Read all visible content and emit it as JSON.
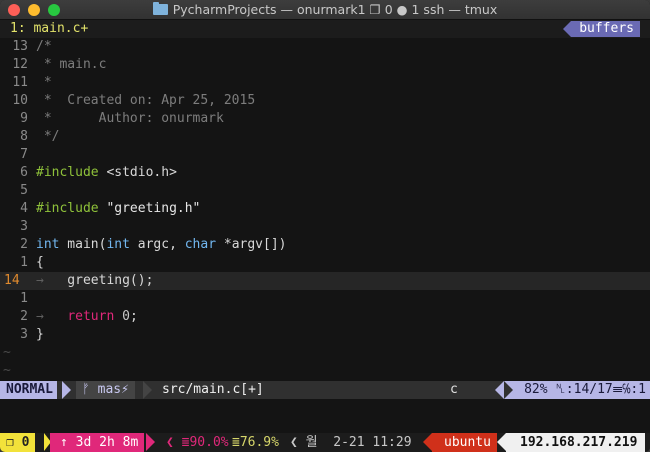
{
  "window": {
    "title": "PycharmProjects — onurmark1 ❐ 0 ● 1 ssh — tmux"
  },
  "tabline": {
    "current_tab": "1: main.c+",
    "buffers_label": "buffers"
  },
  "editor": {
    "lines": [
      {
        "num": "13",
        "text": "/*"
      },
      {
        "num": "12",
        "text": " * main.c"
      },
      {
        "num": "11",
        "text": " *"
      },
      {
        "num": "10",
        "text": " *  Created on: Apr 25, 2015"
      },
      {
        "num": "9",
        "text": " *      Author: onurmark"
      },
      {
        "num": "8",
        "text": " */"
      },
      {
        "num": "7",
        "text": ""
      },
      {
        "num": "6",
        "pre": "#include",
        "rest": " <stdio.h>"
      },
      {
        "num": "5",
        "text": ""
      },
      {
        "num": "4",
        "pre": "#include",
        "str": " \"greeting.h\""
      },
      {
        "num": "3",
        "text": ""
      },
      {
        "num": "2",
        "t1": "int",
        "m1": " main(",
        "t2": "int",
        "m2": " argc, ",
        "t3": "char",
        "m3": " *argv[])"
      },
      {
        "num": "1",
        "text": "{"
      },
      {
        "num": "14",
        "text": "   greeting();",
        "cursor": true
      },
      {
        "num": "1",
        "text": ""
      },
      {
        "num": "2",
        "kw": "return",
        "val": " 0",
        "end": ";"
      },
      {
        "num": "3",
        "text": "}"
      }
    ],
    "tilde": "~"
  },
  "statusline": {
    "mode": "NORMAL",
    "branch": "ᚠ mas⚡",
    "file": "src/main.c[+]",
    "filetype": "c",
    "position": "82% ␤:14/17☰℅:1"
  },
  "tmux": {
    "session": "❐ 0",
    "uptime": "↑ 3d 2h 8m",
    "cpu": "❮ ≣90.0%",
    "mem": "≣76.9%",
    "date": "❮ 월  2-21 11:29",
    "host": "ubuntu",
    "ip": "192.168.217.219"
  },
  "colors": {
    "mode_bg": "#b6b6e6",
    "session_bg": "#f2e23a",
    "uptime_bg": "#e0287a",
    "host_bg": "#d0301a"
  }
}
